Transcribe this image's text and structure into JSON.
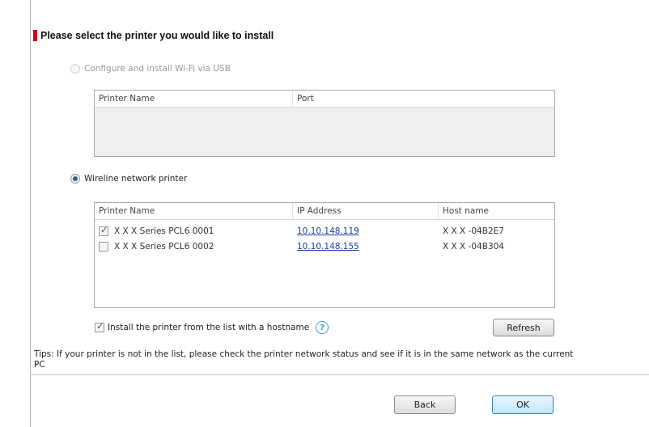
{
  "heading": "Please select the printer you would like to install",
  "usb_option": {
    "label": "Configure and install Wi-Fi via USB",
    "columns": [
      "Printer Name",
      "Port"
    ]
  },
  "network_option": {
    "label": "Wireline network printer",
    "columns": [
      "Printer Name",
      "IP Address",
      "Host name"
    ],
    "rows": [
      {
        "checked": true,
        "name": "X X X  Series PCL6 0001",
        "ip": "10.10.148.119",
        "host": "X X X -04B2E7"
      },
      {
        "checked": false,
        "name": "X X X  Series PCL6 0002",
        "ip": "10.10.148.155",
        "host": "X X X -04B304"
      }
    ]
  },
  "hostname_checkbox": {
    "checked": true,
    "label": "Install the printer from the list with a hostname"
  },
  "refresh_label": "Refresh",
  "tips": "Tips: If your printer is not in the list, please check the printer network status and see if it is in the same network as the current PC",
  "back_label": "Back",
  "ok_label": "OK",
  "colors": {
    "accent_bar": "#d0021b",
    "link": "#1a3fa0"
  }
}
